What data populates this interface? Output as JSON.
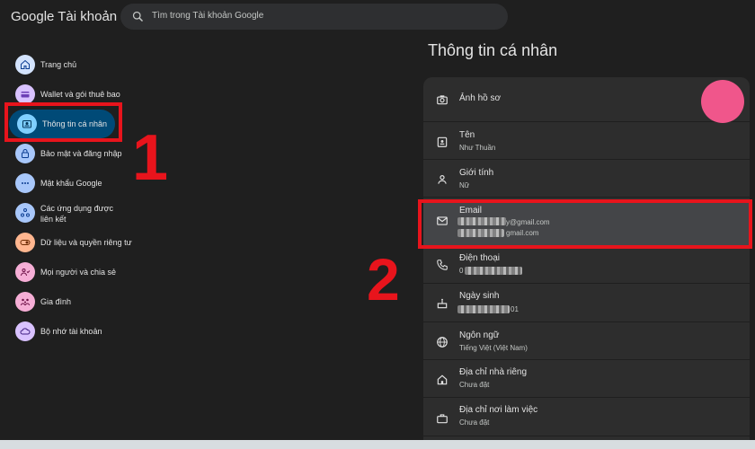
{
  "header": {
    "brand": "Google Tài khoản",
    "search_placeholder": "Tìm trong Tài khoản Google"
  },
  "sidebar": {
    "items": [
      {
        "label": "Trang chủ",
        "icon": "home-icon",
        "color": "#d3e3fd"
      },
      {
        "label": "Wallet và gói thuê bao",
        "icon": "wallet-icon",
        "color": "#d9c2ff"
      },
      {
        "label": "Thông tin cá nhân",
        "icon": "person-card-icon",
        "color": "#7fcfff",
        "active": true
      },
      {
        "label": "Bảo mật và đăng nhập",
        "icon": "lock-icon",
        "color": "#a8c7fa"
      },
      {
        "label": "Mật khẩu Google",
        "icon": "password-icon",
        "color": "#a8c7fa"
      },
      {
        "label": "Các ứng dụng được liên kết",
        "icon": "linked-apps-icon",
        "color": "#a8c7fa"
      },
      {
        "label": "Dữ liệu và quyền riêng tư",
        "icon": "privacy-toggle-icon",
        "color": "#ffb68f"
      },
      {
        "label": "Mọi người và chia sẻ",
        "icon": "people-icon",
        "color": "#f6aed6"
      },
      {
        "label": "Gia đình",
        "icon": "family-icon",
        "color": "#f6aed6"
      },
      {
        "label": "Bộ nhớ tài khoản",
        "icon": "cloud-icon",
        "color": "#d9c2ff"
      }
    ]
  },
  "main": {
    "title": "Thông tin cá nhân",
    "rows": [
      {
        "label": "Ảnh hồ sơ",
        "value": "",
        "icon": "camera-icon"
      },
      {
        "label": "Tên",
        "value": "Như Thuần",
        "icon": "badge-icon"
      },
      {
        "label": "Giới tính",
        "value": "Nữ",
        "icon": "person-icon"
      },
      {
        "label": "Email",
        "value": "y@gmail.com",
        "value2": "gmail.com",
        "icon": "mail-icon"
      },
      {
        "label": "Điện thoại",
        "value": "0",
        "icon": "phone-icon"
      },
      {
        "label": "Ngày sinh",
        "value": "01",
        "icon": "cake-icon"
      },
      {
        "label": "Ngôn ngữ",
        "value": "Tiếng Việt (Việt Nam)",
        "icon": "globe-icon"
      },
      {
        "label": "Địa chỉ nhà riêng",
        "value": "Chưa đặt",
        "icon": "home-icon"
      },
      {
        "label": "Địa chỉ nơi làm việc",
        "value": "Chưa đặt",
        "icon": "work-icon"
      }
    ]
  },
  "annotations": {
    "step1": "1",
    "step2": "2",
    "highlight_color": "#e8141c"
  }
}
